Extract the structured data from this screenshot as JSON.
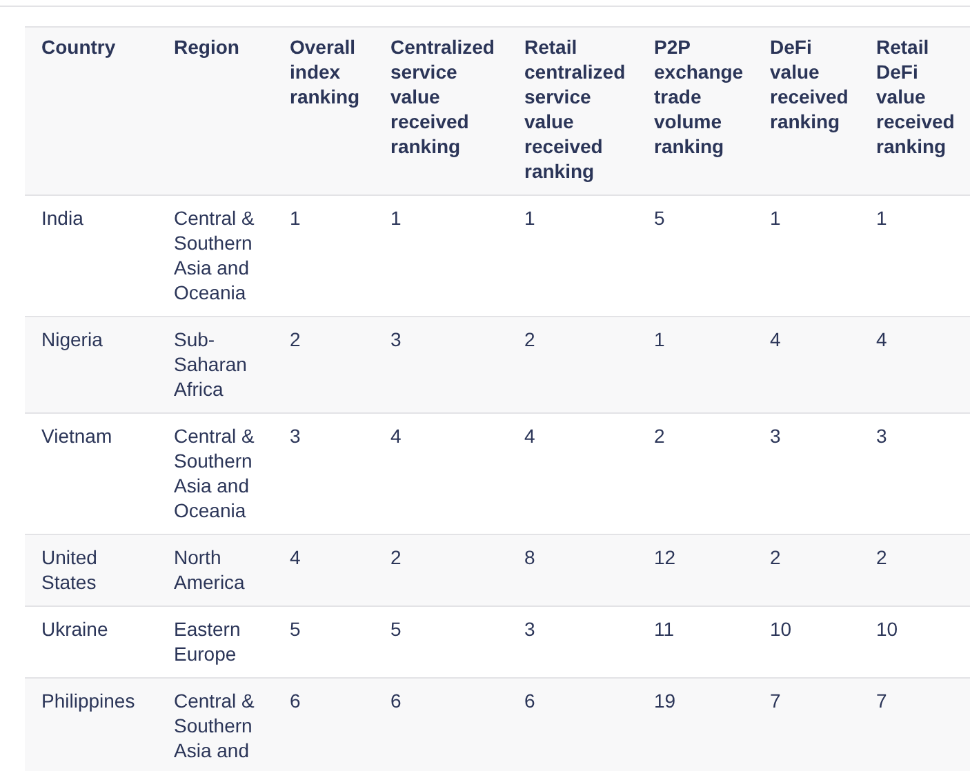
{
  "table": {
    "columns": [
      "Country",
      "Region",
      "Overall index ranking",
      "Centralized service value received ranking",
      "Retail centralized service value received ranking",
      "P2P exchange trade volume ranking",
      "DeFi value received ranking",
      "Retail DeFi value received ranking"
    ],
    "rows": [
      [
        "India",
        "Central & Southern Asia and Oceania",
        "1",
        "1",
        "1",
        "5",
        "1",
        "1"
      ],
      [
        "Nigeria",
        "Sub-Saharan Africa",
        "2",
        "3",
        "2",
        "1",
        "4",
        "4"
      ],
      [
        "Vietnam",
        "Central & Southern Asia and Oceania",
        "3",
        "4",
        "4",
        "2",
        "3",
        "3"
      ],
      [
        "United States",
        "North America",
        "4",
        "2",
        "8",
        "12",
        "2",
        "2"
      ],
      [
        "Ukraine",
        "Eastern Europe",
        "5",
        "5",
        "3",
        "11",
        "10",
        "10"
      ],
      [
        "Philippines",
        "Central & Southern Asia and",
        "6",
        "6",
        "6",
        "19",
        "7",
        "7"
      ]
    ]
  }
}
